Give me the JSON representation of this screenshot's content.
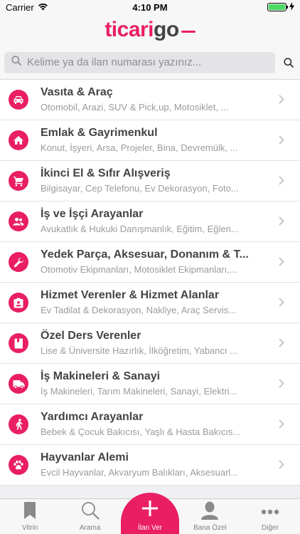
{
  "status": {
    "carrier": "Carrier",
    "time": "4:10 PM"
  },
  "brand": {
    "logo_part1": "ticari",
    "logo_part2": "go"
  },
  "search": {
    "placeholder": "Kelime ya da ilan numarası yazınız..."
  },
  "categories": [
    {
      "title": "Vasıta & Araç",
      "subtitle": "Otomobil, Arazi, SUV & Pick,up, Motosiklet, ...",
      "icon": "car-icon"
    },
    {
      "title": "Emlak & Gayrimenkul",
      "subtitle": "Konut, İşyeri, Arsa, Projeler, Bina, Devremülk, ...",
      "icon": "house-icon"
    },
    {
      "title": "İkinci El & Sıfır Alışveriş",
      "subtitle": "Bilgisayar, Cep Telefonu, Ev Dekorasyon, Foto...",
      "icon": "cart-icon"
    },
    {
      "title": "İş ve İşçi Arayanlar",
      "subtitle": "Avukatlık & Hukuki Danışmanlık, Eğitim, Eğlen...",
      "icon": "people-icon"
    },
    {
      "title": "Yedek Parça, Aksesuar, Donanım & T...",
      "subtitle": "Otomotiv Ekipmanları, Motosiklet Ekipmanları,...",
      "icon": "wrench-icon"
    },
    {
      "title": "Hizmet Verenler & Hizmet Alanlar",
      "subtitle": "Ev Tadilat & Dekorasyon, Nakliye, Araç Servis...",
      "icon": "badge-icon"
    },
    {
      "title": "Özel Ders Verenler",
      "subtitle": "Lise & Üniversite Hazırlık, İlköğretim, Yabancı ...",
      "icon": "book-icon"
    },
    {
      "title": "İş Makineleri & Sanayi",
      "subtitle": "İş Makineleri, Tarım Makineleri, Sanayi, Elektri...",
      "icon": "truck-icon"
    },
    {
      "title": "Yardımcı Arayanlar",
      "subtitle": "Bebek & Çocuk Bakıcısı, Yaşlı & Hasta Bakıcıs...",
      "icon": "walking-person-icon"
    },
    {
      "title": "Hayvanlar Alemi",
      "subtitle": "Evcil Hayvanlar, Akvaryum Balıkları, Aksesuarl...",
      "icon": "paw-icon"
    }
  ],
  "tabs": [
    {
      "label": "Vitrin",
      "icon": "bookmark-icon"
    },
    {
      "label": "Arama",
      "icon": "search-icon"
    },
    {
      "label": "İlan Ver",
      "icon": "plus-icon"
    },
    {
      "label": "Bana Özel",
      "icon": "person-icon"
    },
    {
      "label": "Diğer",
      "icon": "more-dots-icon"
    }
  ],
  "colors": {
    "accent": "#e91e63",
    "text_dark": "#444444",
    "text_muted": "#9b9b9b",
    "background": "#efeff4"
  }
}
